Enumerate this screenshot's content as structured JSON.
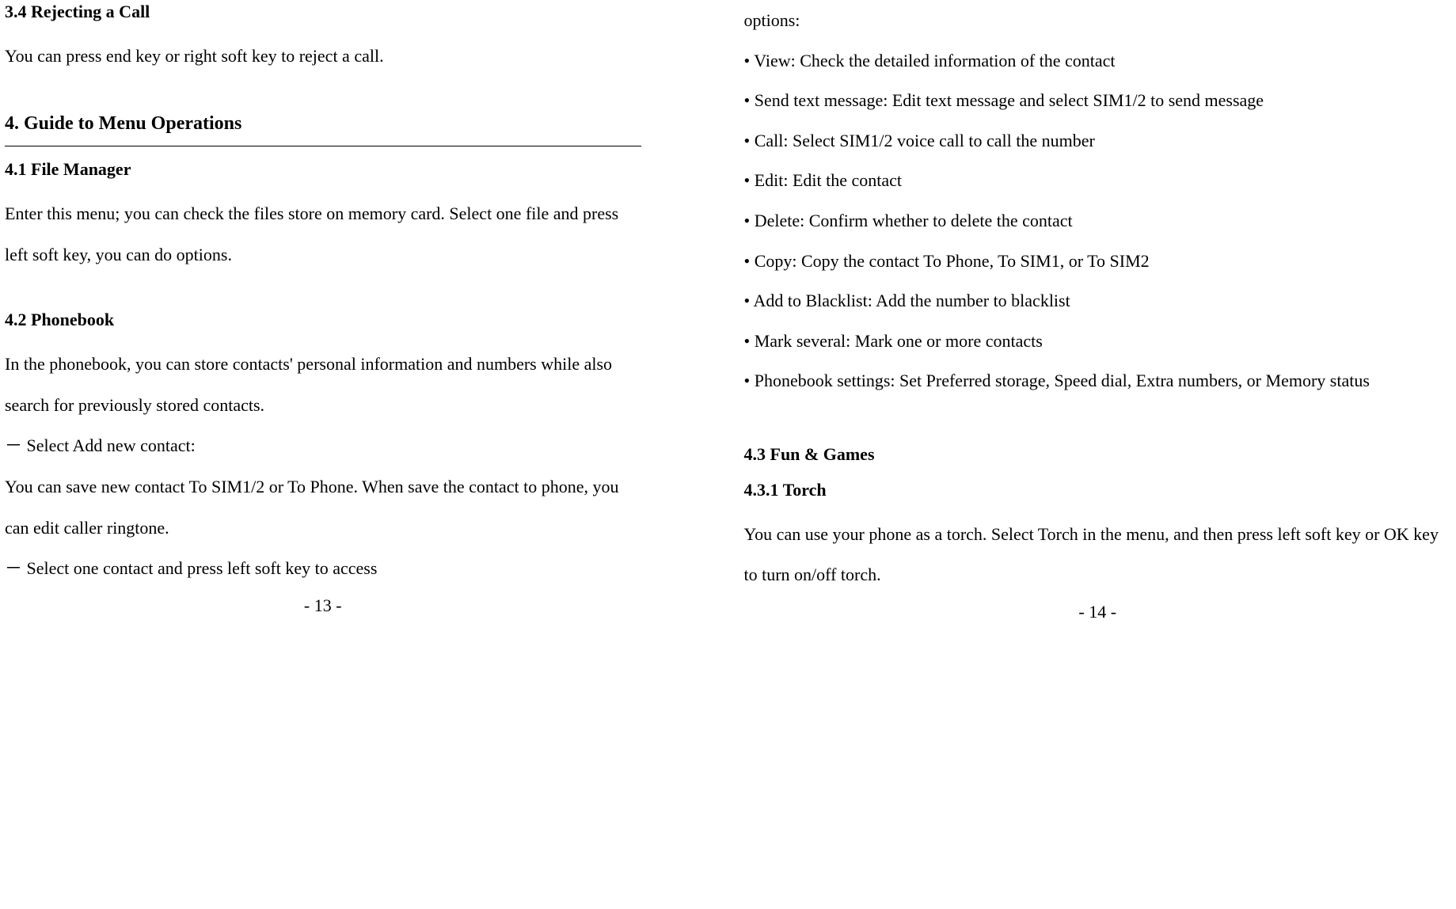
{
  "left": {
    "heading_3_4": "3.4 Rejecting a Call",
    "para_3_4": "You can press end key or right soft key to reject a call.",
    "heading_4": "4. Guide to Menu Operations",
    "heading_4_1": "4.1 File Manager",
    "para_4_1": "Enter this menu; you can check the files store on memory card. Select one file and press left soft key, you can do options.",
    "heading_4_2": "4.2 Phonebook",
    "para_4_2": "In the phonebook, you can store contacts' personal information and numbers while also search for previously stored contacts.",
    "dash_1": "－ Select Add new contact:",
    "para_dash_1": "You can save new contact To SIM1/2 or To Phone. When save the contact to phone, you can edit caller ringtone.",
    "dash_2": "－ Select one contact and press left soft key to access",
    "page_num": "- 13 -"
  },
  "right": {
    "options_cont": "options:",
    "bullets": [
      "• View: Check the detailed information of the contact",
      "• Send text message: Edit text message and select SIM1/2 to send message",
      "• Call: Select SIM1/2 voice call to call the number",
      "• Edit: Edit the contact",
      "• Delete: Confirm whether to delete the contact",
      "• Copy: Copy the contact To Phone, To SIM1, or To SIM2",
      "• Add to Blacklist: Add the number to blacklist",
      "• Mark several: Mark one or more contacts",
      "• Phonebook settings: Set Preferred storage, Speed dial, Extra numbers, or Memory status"
    ],
    "heading_4_3": "4.3 Fun & Games",
    "heading_4_3_1": "4.3.1 Torch",
    "para_4_3_1": "You can use your phone as a torch. Select Torch in the menu, and then press left soft key or OK key to turn on/off torch.",
    "page_num": "- 14 -"
  }
}
